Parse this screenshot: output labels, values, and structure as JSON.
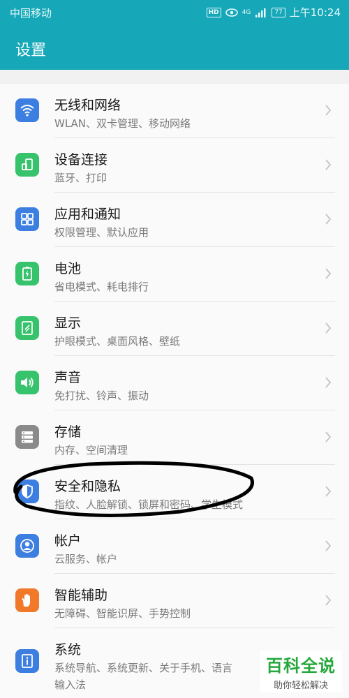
{
  "status": {
    "carrier": "中国移动",
    "hd": "HD",
    "net": "4G",
    "battery": "77",
    "time": "上午10:24"
  },
  "header": {
    "title": "设置"
  },
  "items": [
    {
      "title": "无线和网络",
      "sub": "WLAN、双卡管理、移动网络",
      "color": "#3d7fe0",
      "icon": "wifi-icon"
    },
    {
      "title": "设备连接",
      "sub": "蓝牙、打印",
      "color": "#37c26c",
      "icon": "device-connection-icon"
    },
    {
      "title": "应用和通知",
      "sub": "权限管理、默认应用",
      "color": "#3d7fe0",
      "icon": "apps-grid-icon"
    },
    {
      "title": "电池",
      "sub": "省电模式、耗电排行",
      "color": "#37c26c",
      "icon": "battery-icon"
    },
    {
      "title": "显示",
      "sub": "护眼模式、桌面风格、壁纸",
      "color": "#37c26c",
      "icon": "display-icon"
    },
    {
      "title": "声音",
      "sub": "免打扰、铃声、振动",
      "color": "#37c26c",
      "icon": "speaker-icon"
    },
    {
      "title": "存储",
      "sub": "内存、空间清理",
      "color": "#8a8a8a",
      "icon": "storage-icon"
    },
    {
      "title": "安全和隐私",
      "sub": "指纹、人脸解锁、锁屏和密码、学生模式",
      "color": "#3d7fe0",
      "icon": "shield-icon"
    },
    {
      "title": "帐户",
      "sub": "云服务、帐户",
      "color": "#3d7fe0",
      "icon": "account-icon"
    },
    {
      "title": "智能辅助",
      "sub": "无障碍、智能识屏、手势控制",
      "color": "#f07a2a",
      "icon": "hand-icon"
    },
    {
      "title": "系统",
      "sub": "系统导航、系统更新、关于手机、语言",
      "sub2": "输入法",
      "color": "#3d7fe0",
      "icon": "system-info-icon"
    }
  ],
  "watermark": {
    "main": "百科全说",
    "sub": "助你轻松解决"
  }
}
